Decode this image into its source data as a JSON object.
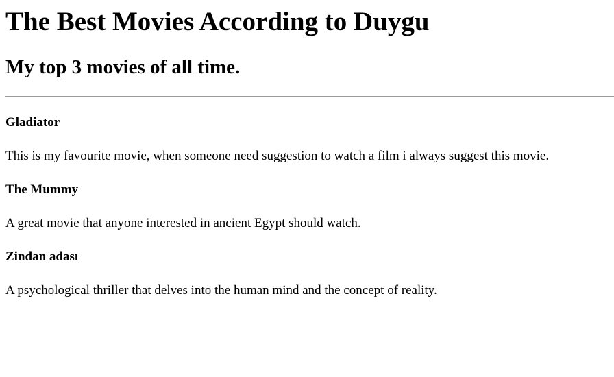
{
  "page": {
    "title": "The Best Movies According to Duygu",
    "subtitle": "My top 3 movies of all time."
  },
  "movies": [
    {
      "title": "Gladiator",
      "description": "This is my favourite movie, when someone need suggestion to watch a film i always suggest this movie."
    },
    {
      "title": "The Mummy",
      "description": "A great movie that anyone interested in ancient Egypt should watch."
    },
    {
      "title": "Zindan adası",
      "description": "A psychological thriller that delves into the human mind and the concept of reality."
    }
  ]
}
